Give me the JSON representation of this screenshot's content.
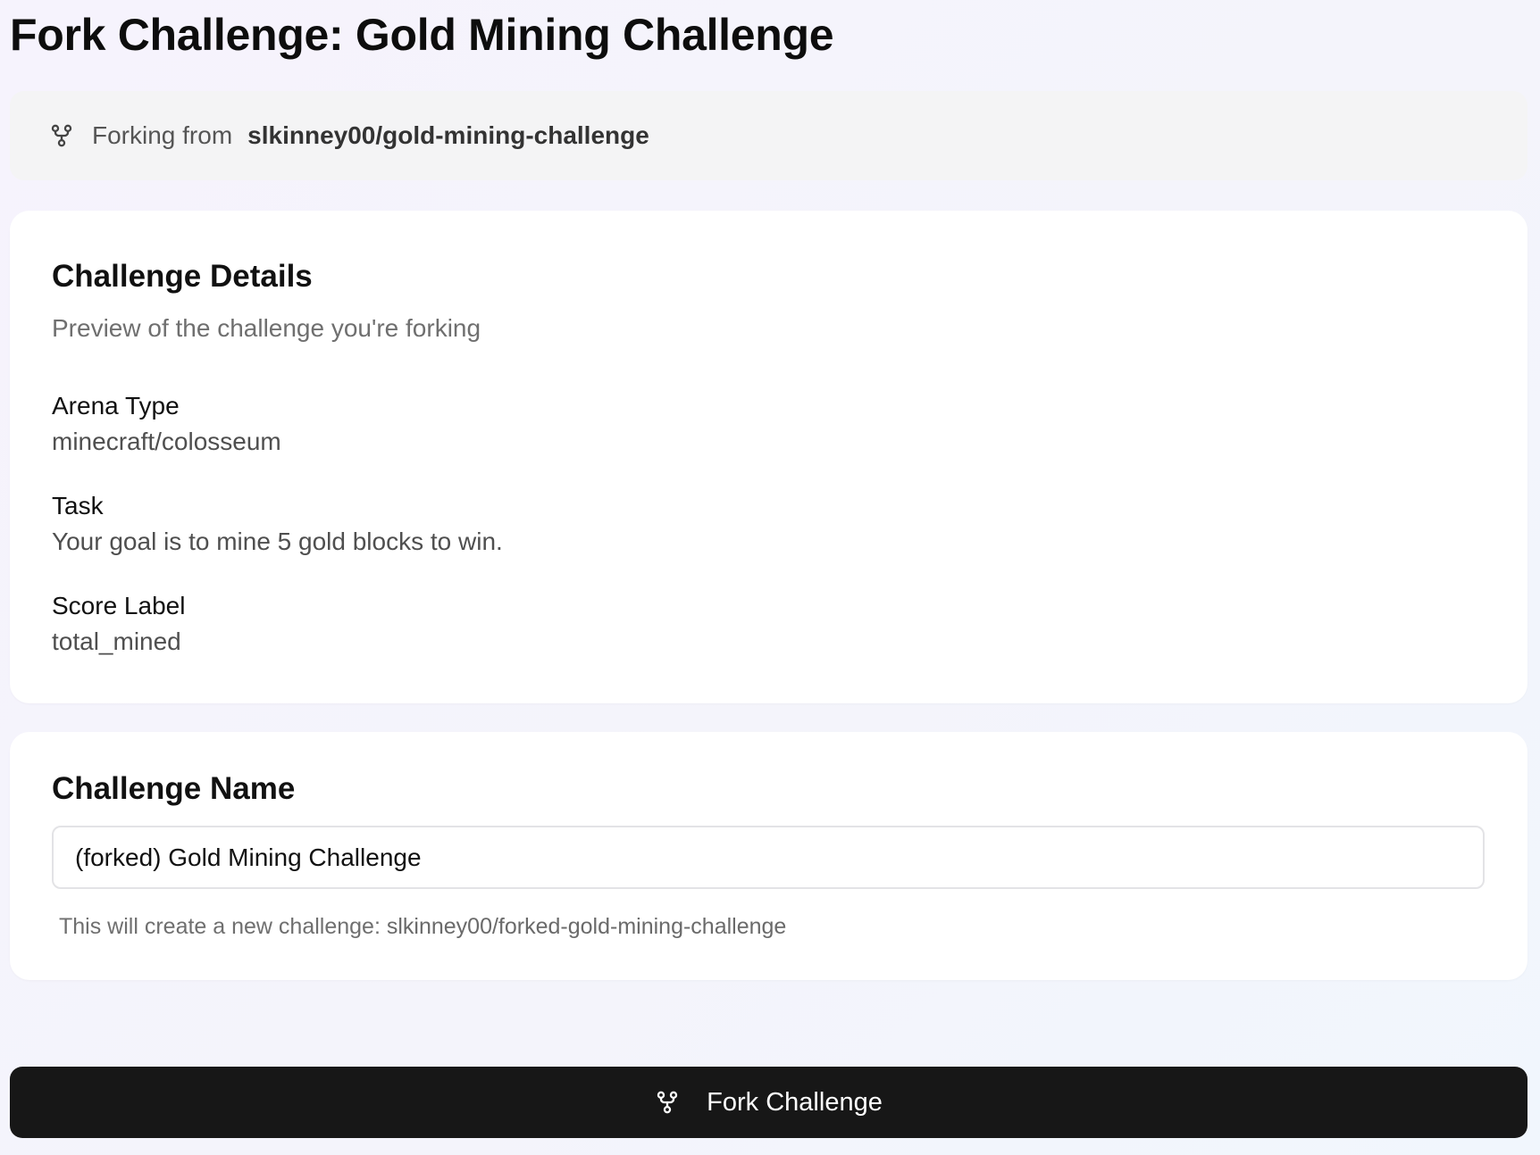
{
  "header": {
    "title": "Fork Challenge: Gold Mining Challenge"
  },
  "fork_source": {
    "label": "Forking from",
    "repo": "slkinney00/gold-mining-challenge",
    "icon": "git-fork-icon"
  },
  "details": {
    "title": "Challenge Details",
    "subtitle": "Preview of the challenge you're forking",
    "fields": [
      {
        "label": "Arena Type",
        "value": "minecraft/colosseum"
      },
      {
        "label": "Task",
        "value": "Your goal is to mine 5 gold blocks to win."
      },
      {
        "label": "Score Label",
        "value": "total_mined"
      }
    ]
  },
  "name_section": {
    "title": "Challenge Name",
    "input_value": "(forked) Gold Mining Challenge",
    "helper_prefix": "This will create a new challenge:",
    "helper_slug": "slkinney00/forked-gold-mining-challenge"
  },
  "actions": {
    "fork_label": "Fork Challenge",
    "fork_icon": "git-fork-icon"
  },
  "colors": {
    "background": "#f5f4fc",
    "card": "#ffffff",
    "source_bar": "#f4f4f5",
    "button": "#171717",
    "button_text": "#ffffff"
  }
}
